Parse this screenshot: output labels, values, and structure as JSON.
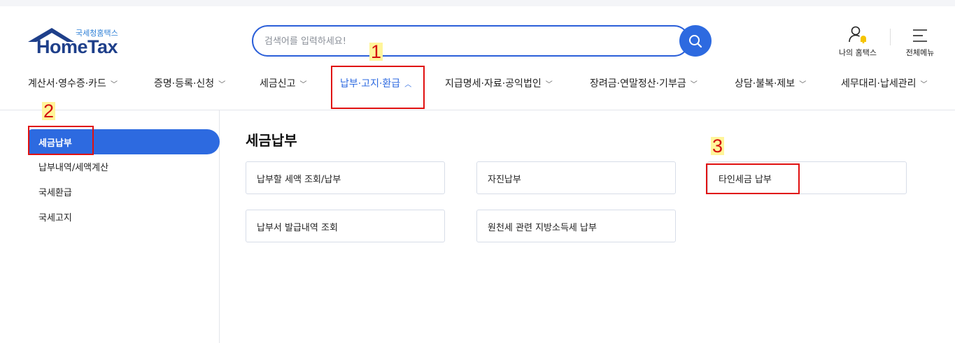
{
  "logo": {
    "korean_name": "국세청홈택스",
    "brand": "HomeTax"
  },
  "search": {
    "placeholder": "검색어를 입력하세요!",
    "icon": "search-icon"
  },
  "utility": {
    "my_hometax": "나의 홈택스",
    "all_menu": "전체메뉴"
  },
  "gnb": {
    "items": [
      {
        "label": "계산서·영수증·카드"
      },
      {
        "label": "증명·등록·신청"
      },
      {
        "label": "세금신고"
      },
      {
        "label": "납부·고지·환급"
      },
      {
        "label": "지급명세·자료·공익법인"
      },
      {
        "label": "장려금·연말정산·기부금"
      },
      {
        "label": "상담·불복·제보"
      },
      {
        "label": "세무대리·납세관리"
      }
    ],
    "active_index": 3
  },
  "sidebar": {
    "items": [
      {
        "label": "세금납부"
      },
      {
        "label": "납부내역/세액계산"
      },
      {
        "label": "국세환급"
      },
      {
        "label": "국세고지"
      }
    ]
  },
  "main": {
    "title": "세금납부",
    "cards": [
      {
        "label": "납부할 세액 조회/납부"
      },
      {
        "label": "자진납부"
      },
      {
        "label": "타인세금 납부"
      },
      {
        "label": "납부서 발급내역 조회"
      },
      {
        "label": "원천세 관련 지방소득세 납부"
      }
    ]
  },
  "annotations": {
    "one": "1",
    "two": "2",
    "three": "3"
  },
  "colors": {
    "accent": "#2d6ae0",
    "brand_navy": "#1e3f8a",
    "annotation_red": "#e01010",
    "highlight_yellow": "#fff59a"
  }
}
